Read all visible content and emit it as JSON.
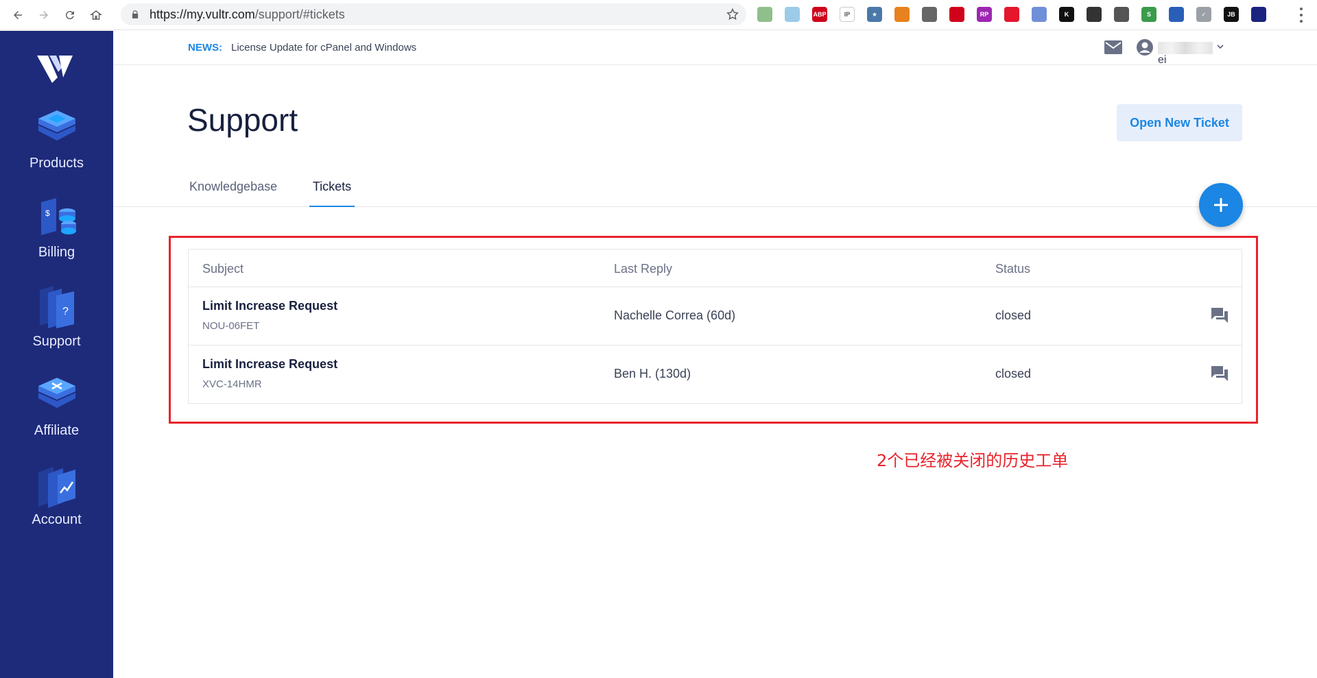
{
  "browser": {
    "url_host": "https://my.vultr.com",
    "url_path": "/support/#tickets",
    "extensions": [
      {
        "name": "green-circle-extension-icon",
        "color": "#8fbf8a",
        "text": ""
      },
      {
        "name": "cloud-extension-icon",
        "color": "#9ccbe8",
        "text": ""
      },
      {
        "name": "adblock-plus-icon",
        "color": "#d0021b",
        "text": "ABP"
      },
      {
        "name": "ip-extension-icon",
        "color": "#ffffff",
        "text": "IP"
      },
      {
        "name": "star-extension-icon",
        "color": "#4a78a8",
        "text": "★"
      },
      {
        "name": "fox-extension-icon",
        "color": "#e8821e",
        "text": ""
      },
      {
        "name": "parachute-extension-icon",
        "color": "#666666",
        "text": ""
      },
      {
        "name": "red-arrow-extension-icon",
        "color": "#d0021b",
        "text": ""
      },
      {
        "name": "rp-extension-icon",
        "color": "#9c27b0",
        "text": "RP"
      },
      {
        "name": "weibo-extension-icon",
        "color": "#e6162d",
        "text": ""
      },
      {
        "name": "blue-circle-extension-icon",
        "color": "#6f8fd8",
        "text": ""
      },
      {
        "name": "black-k-extension-icon",
        "color": "#111111",
        "text": "K"
      },
      {
        "name": "aperture-extension-icon",
        "color": "#333333",
        "text": ""
      },
      {
        "name": "cat-extension-icon",
        "color": "#555555",
        "text": ""
      },
      {
        "name": "green-s-extension-icon",
        "color": "#3a9b4a",
        "text": "S"
      },
      {
        "name": "globe-extension-icon",
        "color": "#2a5fb8",
        "text": ""
      },
      {
        "name": "check-extension-icon",
        "color": "#9aa0a6",
        "text": "✓"
      },
      {
        "name": "jb-extension-icon",
        "color": "#111111",
        "text": "JB"
      },
      {
        "name": "profile-extension-icon",
        "color": "#1a237e",
        "text": ""
      }
    ]
  },
  "sidebar": {
    "items": [
      {
        "label": "Products"
      },
      {
        "label": "Billing"
      },
      {
        "label": "Support"
      },
      {
        "label": "Affiliate"
      },
      {
        "label": "Account"
      }
    ]
  },
  "news": {
    "label": "NEWS:",
    "text": "License Update for cPanel and Windows"
  },
  "user": {
    "name_suffix": "ei"
  },
  "page": {
    "title": "Support",
    "open_ticket_label": "Open New Ticket",
    "tabs": [
      {
        "label": "Knowledgebase",
        "active": false
      },
      {
        "label": "Tickets",
        "active": true
      }
    ]
  },
  "tickets": {
    "headers": {
      "subject": "Subject",
      "last_reply": "Last Reply",
      "status": "Status"
    },
    "rows": [
      {
        "subject": "Limit Increase Request",
        "code": "NOU-06FET",
        "last_reply": "Nachelle Correa (60d)",
        "status": "closed"
      },
      {
        "subject": "Limit Increase Request",
        "code": "XVC-14HMR",
        "last_reply": "Ben H. (130d)",
        "status": "closed"
      }
    ]
  },
  "annotation": {
    "text": "2个已经被关闭的历史工单",
    "color": "#e8232a"
  },
  "colors": {
    "sidebar": "#1e2b7a",
    "accent": "#1b86e3"
  }
}
